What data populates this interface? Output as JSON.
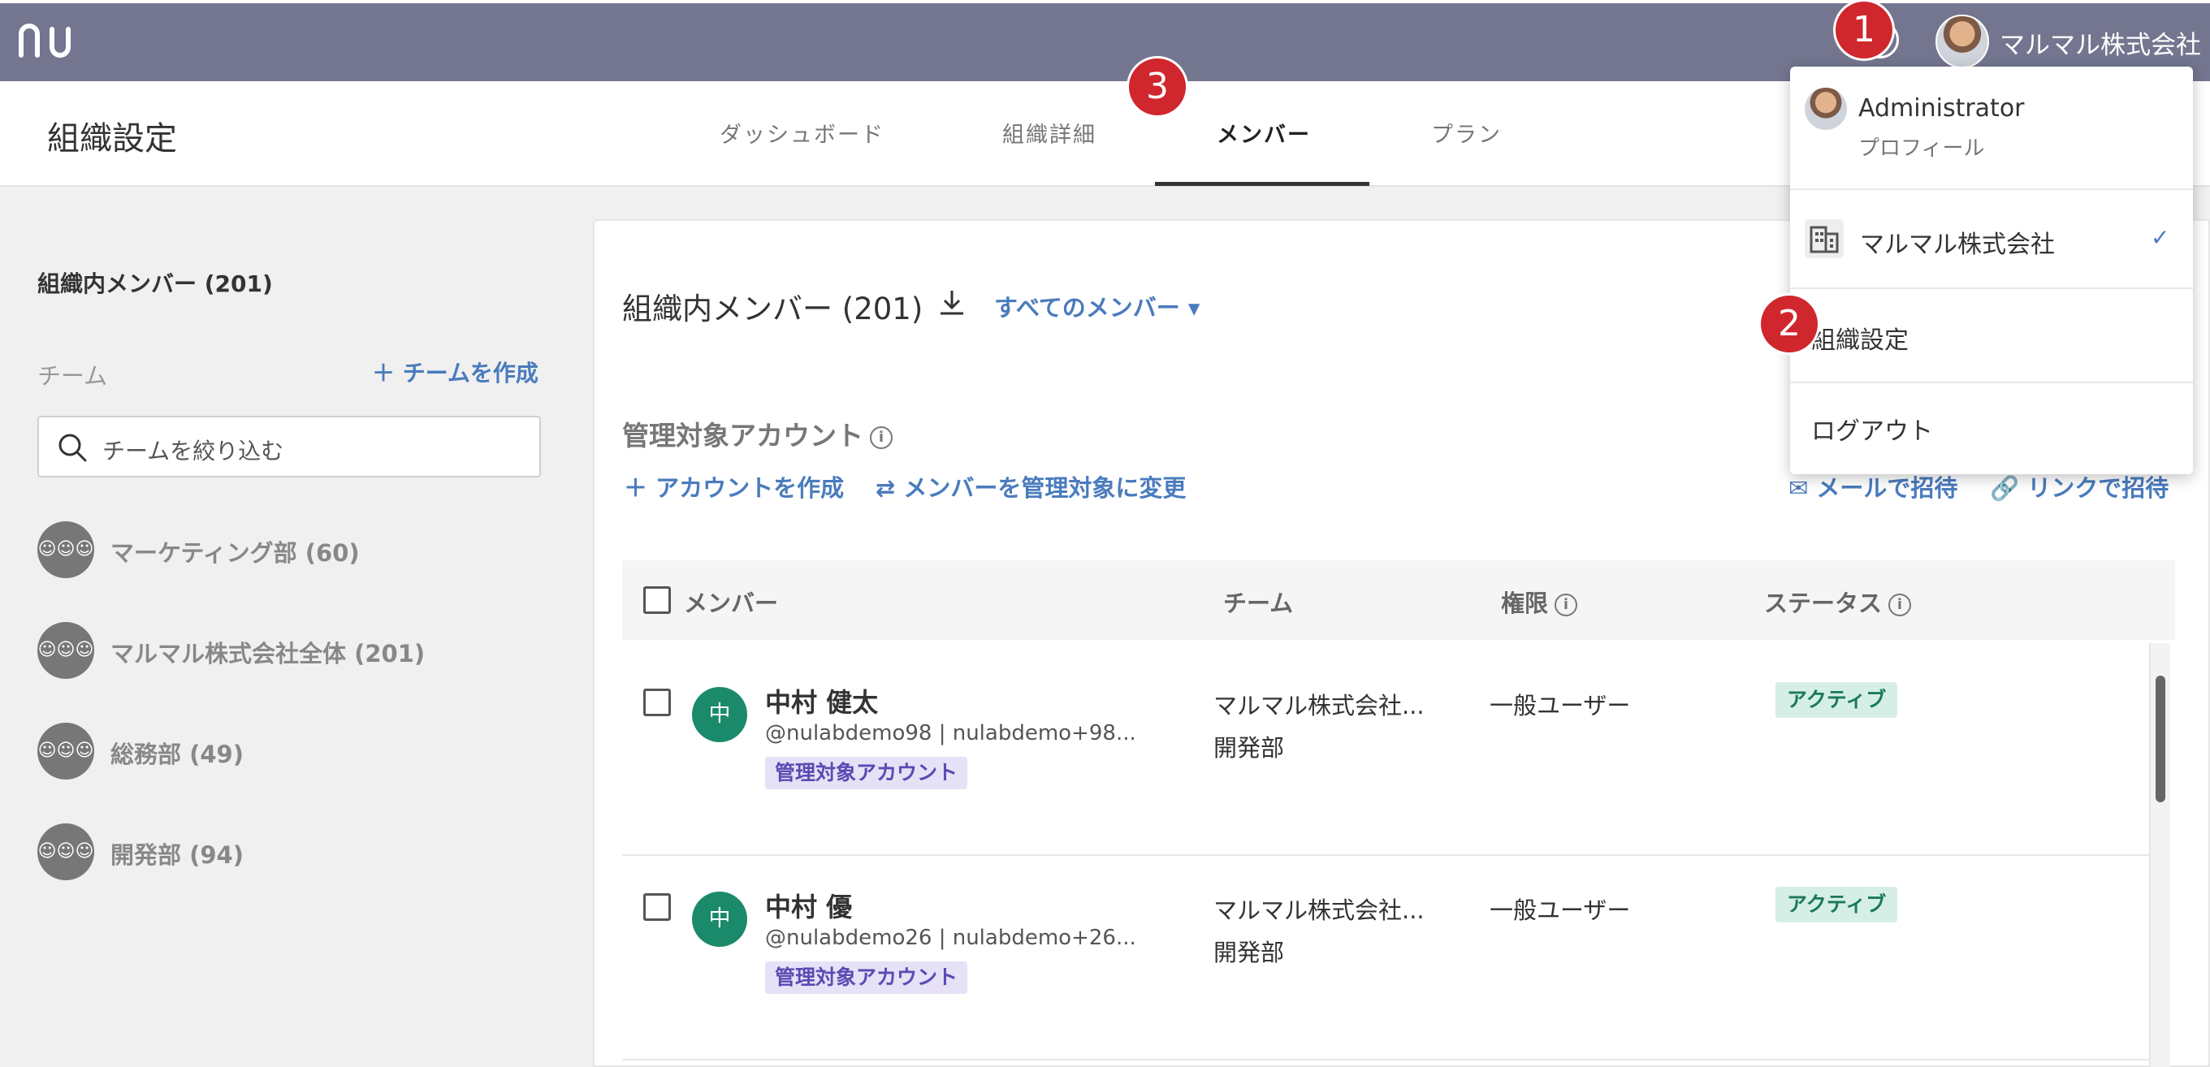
{
  "topbar": {
    "org_name": "マルマル株式会社",
    "help_glyph": "?"
  },
  "header": {
    "title": "組織設定",
    "tabs": [
      {
        "label": "ダッシュボード"
      },
      {
        "label": "組織詳細"
      },
      {
        "label": "メンバー"
      },
      {
        "label": "プラン"
      }
    ]
  },
  "sidebar": {
    "title": "組織内メンバー (201)",
    "team_label": "チーム",
    "create_team": "＋ チームを作成",
    "search_placeholder": "チームを絞り込む",
    "teams": [
      {
        "name": "マーケティング部 (60)"
      },
      {
        "name": "マルマル株式会社全体 (201)"
      },
      {
        "name": "総務部 (49)"
      },
      {
        "name": "開発部 (94)"
      }
    ]
  },
  "main": {
    "title": "組織内メンバー (201)",
    "filter": "すべてのメンバー ▾",
    "managed_title": "管理対象アカウント",
    "create_account": "＋ アカウントを作成",
    "convert_member": "⇄ メンバーを管理対象に変更",
    "invite_mail": "✉ メールで招待",
    "invite_link": "🔗 リンクで招待",
    "columns": {
      "member": "メンバー",
      "team": "チーム",
      "role": "権限",
      "status": "ステータス"
    },
    "rows": [
      {
        "initial": "中",
        "name": "中村 健太",
        "handle": "@nulabdemo98 | nulabdemo+98...",
        "badge": "管理対象アカウント",
        "team1": "マルマル株式会社...",
        "team2": "開発部",
        "role": "一般ユーザー",
        "status": "アクティブ"
      },
      {
        "initial": "中",
        "name": "中村 優",
        "handle": "@nulabdemo26 | nulabdemo+26...",
        "badge": "管理対象アカウント",
        "team1": "マルマル株式会社...",
        "team2": "開発部",
        "role": "一般ユーザー",
        "status": "アクティブ"
      }
    ]
  },
  "dropdown": {
    "user": "Administrator",
    "profile": "プロフィール",
    "org": "マルマル株式会社",
    "check": "✓",
    "settings": "組織設定",
    "logout": "ログアウト"
  },
  "markers": [
    "1",
    "2",
    "3"
  ],
  "colors": {
    "topbar": "#747690",
    "accent": "#4a7bbd",
    "marker": "#d0262d",
    "avatar_green": "#1a8a6a"
  }
}
